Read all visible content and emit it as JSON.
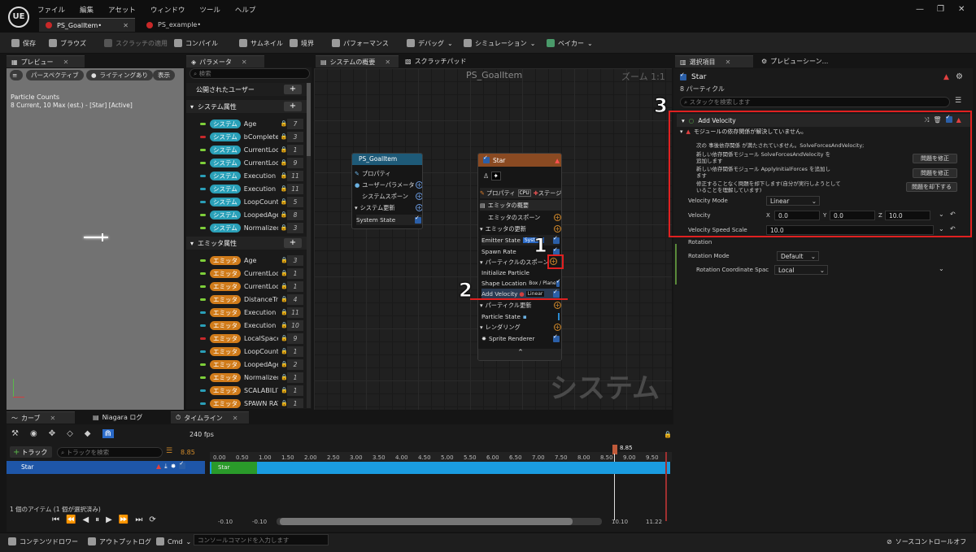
{
  "menu": [
    "ファイル",
    "編集",
    "アセット",
    "ウィンドウ",
    "ツール",
    "ヘルプ"
  ],
  "tabs": [
    {
      "label": "PS_GoalItem•"
    },
    {
      "label": "PS_example•"
    }
  ],
  "logo_text": "UE",
  "window_controls": {
    "minimize": "—",
    "maximize": "❐",
    "close": "✕"
  },
  "toolbar": {
    "save": "保存",
    "browse": "ブラウズ",
    "scratch": "スクラッチの適用",
    "compile": "コンパイル",
    "thumbnail": "サムネイル",
    "bounds": "境界",
    "performance": "パフォーマンス",
    "debug": "デバッグ",
    "simulation": "シミュレーション",
    "bake": "ベイカー"
  },
  "preview": {
    "tab": "プレビュー",
    "buttons": [
      "パースペクティブ",
      "ライティングあり",
      "表示"
    ],
    "count_title": "Particle Counts",
    "count_line": "8 Current, 10 Max (est.) - [Star] [Active]"
  },
  "params": {
    "tab": "パラメータ",
    "search_placeholder": "検索",
    "user_section": "公開されたユーザー",
    "system_section": "システム属性",
    "emitter_section": "エミッタ属性",
    "system_tag": "システム",
    "emitter_tag": "エミッタ",
    "system_rows": [
      {
        "name": "Age",
        "count": "7",
        "color": "#7ecf3a"
      },
      {
        "name": "bComplete(",
        "count": "3",
        "color": "#c8282b"
      },
      {
        "name": "CurrentLoo",
        "count": "1",
        "color": "#7ecf3a"
      },
      {
        "name": "CurrentLoo",
        "count": "9",
        "color": "#7ecf3a"
      },
      {
        "name": "Execution",
        "count": "11",
        "color": "#2a9fb8"
      },
      {
        "name": "Execution",
        "count": "11",
        "color": "#2a9fb8"
      },
      {
        "name": "LoopCount",
        "count": "5",
        "color": "#2a9fb8"
      },
      {
        "name": "LoopedAge",
        "count": "8",
        "color": "#7ecf3a"
      },
      {
        "name": "Normalized",
        "count": "3",
        "color": "#7ecf3a"
      }
    ],
    "emitter_rows": [
      {
        "name": "Age",
        "count": "3",
        "color": "#7ecf3a"
      },
      {
        "name": "CurrentLoo",
        "count": "1",
        "color": "#7ecf3a"
      },
      {
        "name": "CurrentLoo",
        "count": "1",
        "color": "#7ecf3a"
      },
      {
        "name": "DistanceTr",
        "count": "4",
        "color": "#7ecf3a"
      },
      {
        "name": "Execution",
        "count": "11",
        "color": "#2a9fb8"
      },
      {
        "name": "Execution",
        "count": "10",
        "color": "#2a9fb8"
      },
      {
        "name": "LocalSpace",
        "count": "9",
        "color": "#c8282b"
      },
      {
        "name": "LoopCount",
        "count": "1",
        "color": "#2a9fb8"
      },
      {
        "name": "LoopedAge",
        "count": "2",
        "color": "#7ecf3a"
      },
      {
        "name": "Normalized",
        "count": "1",
        "color": "#7ecf3a"
      },
      {
        "name": "SCALABILIT",
        "count": "1",
        "color": "#2a9fb8"
      },
      {
        "name": "SPAWN RAT",
        "count": "1",
        "color": "#2a9fb8"
      }
    ]
  },
  "graph": {
    "tabs": [
      "システムの概要",
      "スクラッチパッド"
    ],
    "title": "PS_GoalItem",
    "zoom": "ズーム 1:1",
    "watermark": "システム",
    "sys_node": {
      "title": "PS_GoalItem",
      "rows": [
        "プロパティ",
        "ユーザーパラメータ",
        "システムスポーン",
        "システム更新",
        "System State"
      ]
    },
    "star_node": {
      "title": "Star",
      "props": "プロパティ",
      "stage": "ステージ",
      "summary": "エミッタの概要",
      "spawn": "エミッタのスポーン",
      "update": "エミッタの更新",
      "emitter_state": "Emitter State",
      "emitter_state_tag": "System",
      "spawn_rate": "Spawn Rate",
      "particle_spawn": "パーティクルのスポーン",
      "init": "Initialize Particle",
      "shape": "Shape Location",
      "shape_tag": "Box / Plane",
      "add_vel": "Add Velocity",
      "add_vel_tag": "Linear",
      "particle_update": "パーティクル更新",
      "particle_state": "Particle State",
      "rendering": "レンダリング",
      "sprite": "Sprite Renderer"
    }
  },
  "selection": {
    "tab": "選択項目",
    "tab2": "プレビューシーン...",
    "name": "Star",
    "count": "8 パーティクル",
    "search_placeholder": "スタックを検索します",
    "module": "Add Velocity",
    "warn_title": "モジュールの依存関係が解決していません。",
    "dep_line": "次の 事後依存関係 が満たされていません。SolveForcesAndVelocity;",
    "issues": [
      {
        "text": "新しい依存関係モジュール SolveForcesAndVelocity を追加します",
        "button": "問題を修正"
      },
      {
        "text": "新しい依存関係モジュール ApplyInitialForces を追加します",
        "button": "問題を修正"
      },
      {
        "text": "修正することなく問題を却下します(自分が実行しようとしていることを理解しています)",
        "button": "問題を却下する"
      }
    ],
    "velocity_mode_label": "Velocity Mode",
    "velocity_mode": "Linear",
    "velocity_label": "Velocity",
    "x_label": "X",
    "y_label": "Y",
    "z_label": "Z",
    "vx": "0.0",
    "vy": "0.0",
    "vz": "10.0",
    "speed_label": "Velocity Speed Scale",
    "speed": "10.0",
    "rotation": "Rotation",
    "rotation_mode_label": "Rotation Mode",
    "rotation_mode": "Default",
    "rot_space_label": "Rotation Coordinate Spac",
    "rot_space": "Local"
  },
  "timeline": {
    "tabs": [
      "カーブ",
      "Niagara ログ",
      "タイムライン"
    ],
    "fps": "240 fps",
    "add_track": "トラック",
    "search_placeholder": "トラックを検索",
    "time_val": "8.85",
    "track": "Star",
    "track_bar": "Star",
    "marker": "8.85",
    "ticks": [
      "0.00",
      "0.50",
      "1.00",
      "1.50",
      "2.00",
      "2.50",
      "3.00",
      "3.50",
      "4.00",
      "4.50",
      "5.00",
      "5.50",
      "6.00",
      "6.50",
      "7.00",
      "7.50",
      "8.00",
      "8.50",
      "9.00",
      "9.50"
    ],
    "items": "1 個のアイテム (1 個が選択済み)",
    "range_start": "-0.10",
    "range_start2": "-0.10",
    "range_end": "10.10",
    "range_end2": "11.22"
  },
  "statusbar": {
    "drawer": "コンテンツドロワー",
    "output": "アウトプットログ",
    "cmd": "Cmd",
    "console_placeholder": "コンソールコマンドを入力します",
    "source": "ソースコントロールオフ"
  },
  "annotations": {
    "one": "1",
    "two": "2",
    "three": "3"
  }
}
